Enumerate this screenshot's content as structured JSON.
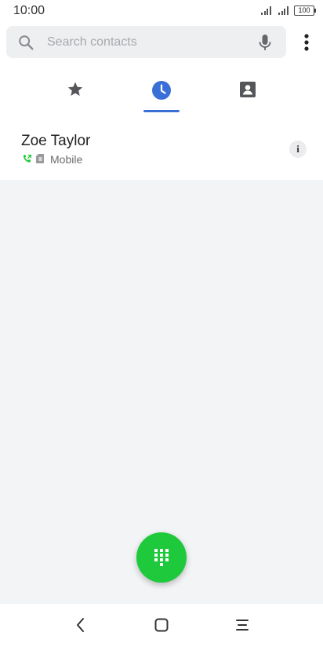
{
  "status_bar": {
    "time": "10:00",
    "battery": "100"
  },
  "search": {
    "placeholder": "Search contacts",
    "value": ""
  },
  "tabs": [
    {
      "name": "favorites",
      "icon": "star-icon",
      "selected": false
    },
    {
      "name": "recents",
      "icon": "clock-icon",
      "selected": true
    },
    {
      "name": "contacts",
      "icon": "contact-card-icon",
      "selected": false
    }
  ],
  "recent_calls": [
    {
      "name": "Zoe Taylor",
      "call_type_icon": "outgoing-call-icon",
      "sim_icon": "sim-card-icon",
      "label": "Mobile",
      "info": "i"
    }
  ],
  "colors": {
    "accent": "#3b6fd8",
    "fab": "#1ec93b",
    "call_icon": "#1ec93b",
    "background": "#f3f4f6"
  }
}
